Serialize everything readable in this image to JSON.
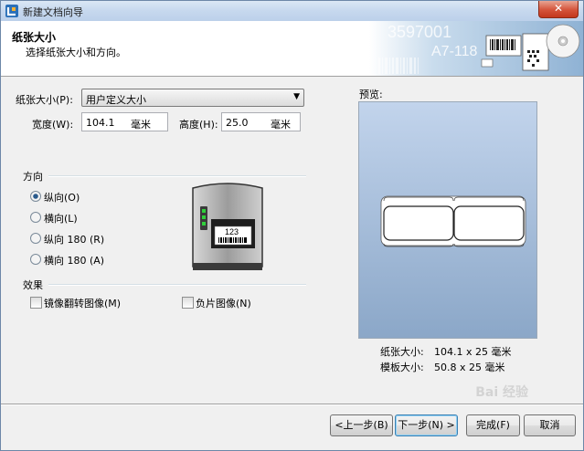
{
  "window": {
    "title": "新建文档向导",
    "close_label": "✕"
  },
  "header": {
    "title": "纸张大小",
    "subtitle": "选择纸张大小和方向。",
    "art_text_1": "3597001",
    "art_text_2": "A7-118"
  },
  "paper": {
    "size_label": "纸张大小(P):",
    "size_value": "用户定义大小",
    "width_label": "宽度(W):",
    "width_value": "104.1",
    "width_unit": "毫米",
    "height_label": "高度(H):",
    "height_value": "25.0",
    "height_unit": "毫米"
  },
  "orientation": {
    "group_label": "方向",
    "options": [
      {
        "label": "纵向(O)",
        "checked": true
      },
      {
        "label": "横向(L)",
        "checked": false
      },
      {
        "label": "纵向 180 (R)",
        "checked": false
      },
      {
        "label": "横向 180 (A)",
        "checked": false
      }
    ]
  },
  "effects": {
    "group_label": "效果",
    "mirror_label": "镜像翻转图像(M)",
    "negative_label": "负片图像(N)"
  },
  "printer_label_text": "123",
  "preview": {
    "label": "预览:",
    "paper_size_label": "纸张大小:",
    "paper_size_value": "104.1 x 25 毫米",
    "template_size_label": "模板大小:",
    "template_size_value": "50.8 x 25 毫米"
  },
  "buttons": {
    "back": "<上一步(B)",
    "next": "下一步(N) >",
    "finish": "完成(F)",
    "cancel": "取消"
  },
  "watermark": "Bai 经验"
}
